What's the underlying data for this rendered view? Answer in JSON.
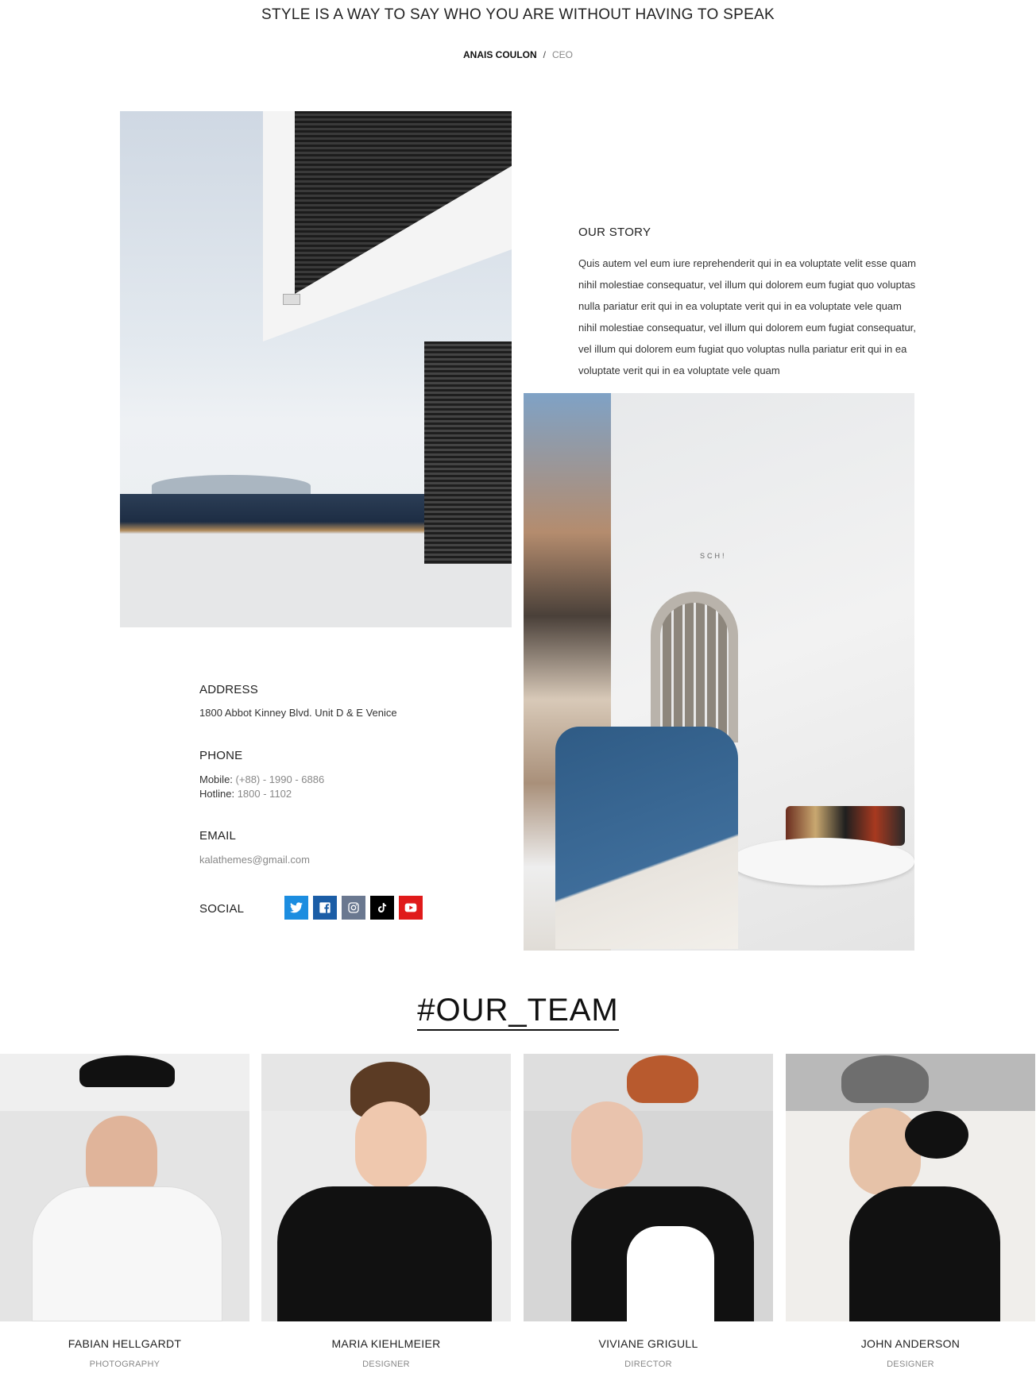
{
  "header": {
    "quote": "STYLE IS A WAY TO SAY WHO YOU ARE WITHOUT HAVING TO SPEAK",
    "author_name": "ANAIS COULON",
    "separator": "/",
    "author_role": "CEO"
  },
  "story": {
    "title": "OUR STORY",
    "text": "Quis autem vel eum iure reprehenderit qui in ea voluptate velit esse quam nihil molestiae consequatur, vel illum qui dolorem eum fugiat quo voluptas nulla pariatur erit qui in ea voluptate verit qui in ea voluptate vele quam nihil molestiae consequatur, vel illum qui dolorem eum fugiat consequatur, vel illum qui dolorem eum fugiat quo voluptas nulla pariatur erit qui in ea voluptate verit qui in ea voluptate vele quam"
  },
  "store_sign": "SCH!",
  "contact": {
    "address_label": "ADDRESS",
    "address": "1800 Abbot Kinney Blvd. Unit D & E Venice",
    "phone_label": "PHONE",
    "mobile_label": "Mobile:",
    "mobile": "(+88) - 1990 - 6886",
    "hotline_label": "Hotline:",
    "hotline": "1800 - 1102",
    "email_label": "EMAIL",
    "email": "kalathemes@gmail.com",
    "social_label": "SOCIAL",
    "social_icons": [
      "twitter-icon",
      "facebook-icon",
      "instagram-icon",
      "tiktok-icon",
      "youtube-icon"
    ]
  },
  "team": {
    "title": "#OUR_TEAM",
    "members": [
      {
        "name": "FABIAN HELLGARDT",
        "role": "PHOTOGRAPHY"
      },
      {
        "name": "MARIA KIEHLMEIER",
        "role": "DESIGNER"
      },
      {
        "name": "VIVIANE GRIGULL",
        "role": "DIRECTOR"
      },
      {
        "name": "JOHN ANDERSON",
        "role": "DESIGNER"
      }
    ]
  },
  "colors": {
    "twitter": "#1c8de0",
    "facebook": "#1b5da6",
    "instagram": "#6a7890",
    "tiktok": "#000000",
    "youtube": "#e01a1a"
  }
}
